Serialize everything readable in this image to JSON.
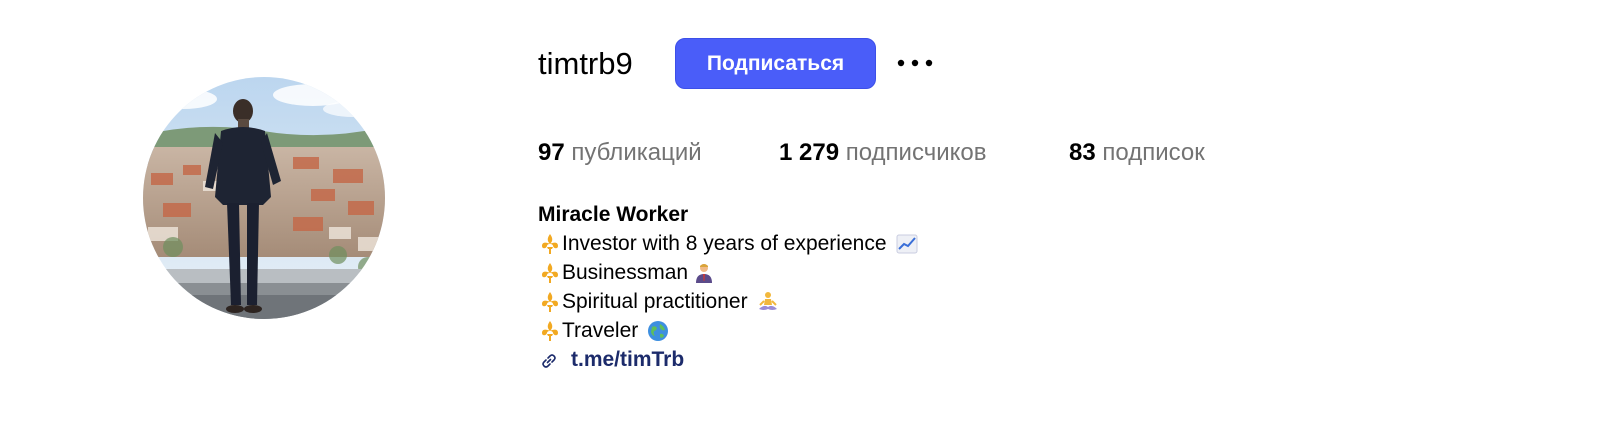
{
  "profile": {
    "username": "timtrb9",
    "follow_label": "Подписаться",
    "stats": [
      {
        "count": "97",
        "label": "публикаций"
      },
      {
        "count": "1 279",
        "label": "подписчиков"
      },
      {
        "count": "83",
        "label": "подписок"
      }
    ],
    "bio": {
      "name": "Miracle Worker",
      "lines": [
        {
          "text": "Investor with 8 years of experience",
          "icon": "fleur-de-lis-icon",
          "trail_icon": "chart-increasing-icon"
        },
        {
          "text": "Businessman",
          "icon": "fleur-de-lis-icon",
          "trail_icon": "businessman-icon"
        },
        {
          "text": "Spiritual practitioner",
          "icon": "fleur-de-lis-icon",
          "trail_icon": "meditation-icon"
        },
        {
          "text": "Traveler",
          "icon": "fleur-de-lis-icon",
          "trail_icon": "globe-icon"
        }
      ],
      "link": "t.me/timTrb"
    }
  },
  "colors": {
    "accent": "#4a5df9",
    "secondary_text": "#737373",
    "link": "#1c2b6b"
  }
}
